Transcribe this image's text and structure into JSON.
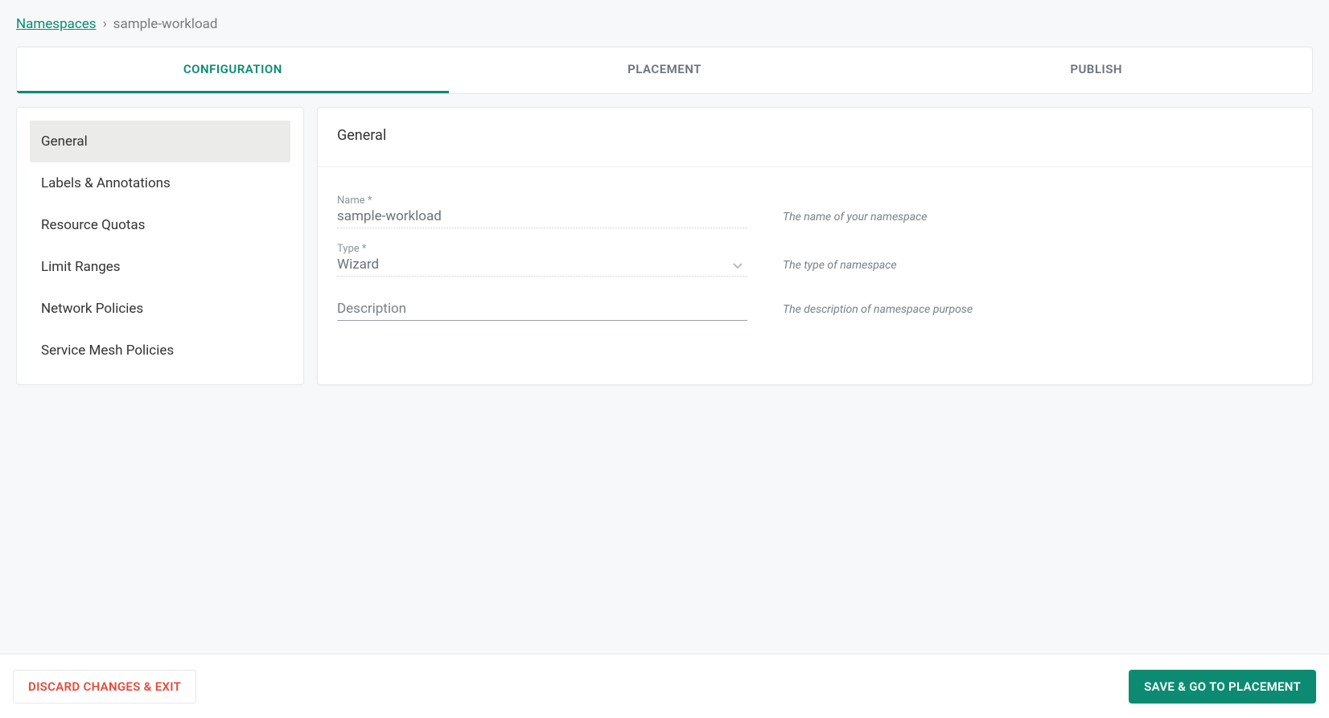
{
  "breadcrumb": {
    "root": "Namespaces",
    "sep": "›",
    "current": "sample-workload"
  },
  "tabs": [
    {
      "label": "CONFIGURATION",
      "active": true
    },
    {
      "label": "PLACEMENT",
      "active": false
    },
    {
      "label": "PUBLISH",
      "active": false
    }
  ],
  "sidebar": {
    "items": [
      "General",
      "Labels & Annotations",
      "Resource Quotas",
      "Limit Ranges",
      "Network Policies",
      "Service Mesh Policies"
    ],
    "activeIndex": 0
  },
  "panel": {
    "title": "General",
    "fields": {
      "name": {
        "label": "Name *",
        "value": "sample-workload",
        "hint": "The name of your namespace"
      },
      "type": {
        "label": "Type *",
        "value": "Wizard",
        "hint": "The type of namespace"
      },
      "description": {
        "label": "Description",
        "value": "",
        "hint": "The description of namespace purpose"
      }
    }
  },
  "footer": {
    "discard": "DISCARD CHANGES & EXIT",
    "save": "SAVE & GO TO PLACEMENT"
  }
}
